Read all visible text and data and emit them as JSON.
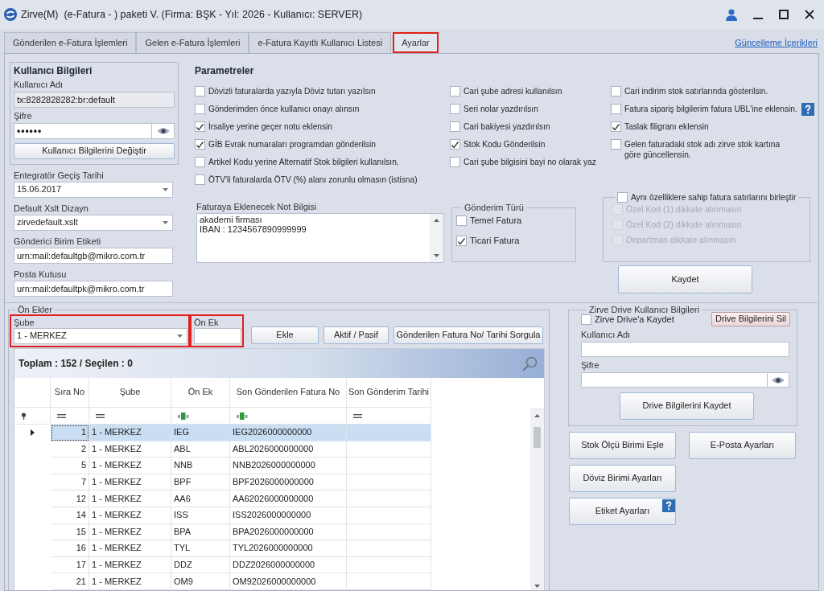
{
  "window": {
    "title": "Zirve(M)  (e-Fatura - ) paketi V. (Firma: BŞK - Yıl: 2026 - Kullanıcı: SERVER)"
  },
  "tabs": [
    {
      "label": "Gönderilen e-Fatura İşlemleri",
      "selected": false,
      "highlighted": false
    },
    {
      "label": "Gelen e-Fatura İşlemleri",
      "selected": false,
      "highlighted": false
    },
    {
      "label": "e-Fatura Kayıtlı Kullanıcı Listesi",
      "selected": false,
      "highlighted": false
    },
    {
      "label": "Ayarlar",
      "selected": true,
      "highlighted": true
    }
  ],
  "update_link": "Güncelleme İçerikleri",
  "user_info": {
    "title": "Kullanıcı Bilgileri",
    "username_label": "Kullanıcı Adı",
    "username": "tx:8282828282:br:default",
    "password_label": "Şifre",
    "password": "••••••",
    "change_button": "Kullanıcı Bilgilerini Değiştir"
  },
  "settings_fields": [
    {
      "kind": "combo",
      "label": "Entegratör Geçiş Tarihi",
      "value": "15.06.2017"
    },
    {
      "kind": "combo",
      "label": "Default Xslt Dizayn",
      "value": "zirvedefault.xslt"
    },
    {
      "kind": "text",
      "label": "Gönderici Birim Etiketi",
      "value": "urn:mail:defaultgb@mikro.com.tr"
    },
    {
      "kind": "text",
      "label": "Posta Kutusu",
      "value": "urn:mail:defaultpk@mikro.com.tr"
    }
  ],
  "parameters": {
    "title": "Parametreler",
    "columns": [
      {
        "options": [
          {
            "label": "Dövizli faturalarda yazıyla Döviz tutarı yazılsın",
            "checked": false
          },
          {
            "label": "Gönderimden önce kullanıcı onayı alınsın",
            "checked": false
          },
          {
            "label": "İrsaliye yerine geçer notu eklensin",
            "checked": true
          },
          {
            "label": "GİB Evrak numaraları programdan gönderilsin",
            "checked": true
          },
          {
            "label": "Artikel Kodu yerine Alternatif Stok bilgileri kullanılsın.",
            "checked": false
          },
          {
            "label": "ÖTV'li faturalarda ÖTV (%) alanı zorunlu olmasın (istisna)",
            "checked": false
          }
        ]
      },
      {
        "options": [
          {
            "label": "Cari şube adresi kullanılsın",
            "checked": false
          },
          {
            "label": "Seri nolar yazdırılsın",
            "checked": false
          },
          {
            "label": "Cari bakiyesi yazdırılsın",
            "checked": false
          },
          {
            "label": "Stok Kodu Gönderilsin",
            "checked": true
          },
          {
            "label": "Cari şube bilgisini bayi no olarak yaz",
            "checked": false
          }
        ]
      },
      {
        "options": [
          {
            "label": "Cari indirim stok satırlarında gösterilsin.",
            "checked": false
          },
          {
            "label": "Fatura sipariş bilgilerim fatura UBL'ine eklensin.",
            "checked": false,
            "help": true
          },
          {
            "label": "Taslak filigranı eklensin",
            "checked": true
          },
          {
            "label": "Gelen faturadaki stok adı zirve stok kartına göre güncellensin.",
            "checked": false
          }
        ]
      }
    ]
  },
  "note": {
    "label": "Faturaya Eklenecek Not Bilgisi",
    "lines": [
      "akademi firması",
      "IBAN : 1234567890999999"
    ]
  },
  "send_type": {
    "title": "Gönderim Türü",
    "options": [
      {
        "label": "Temel Fatura",
        "checked": false
      },
      {
        "label": "Ticari Fatura",
        "checked": true
      }
    ]
  },
  "merge_group": {
    "label": "Aynı özelliklere sahip fatura satırlarını birleştir",
    "checked": false,
    "options": [
      {
        "label": "Özel Kod (1) dikkate alınmasın",
        "checked": false,
        "disabled": true
      },
      {
        "label": "Özel Kod (2) dikkate alınmasın",
        "checked": false,
        "disabled": true
      },
      {
        "label": "Departman dikkate alınmasın",
        "checked": false,
        "disabled": true
      }
    ]
  },
  "save_button": "Kaydet",
  "prefixes": {
    "title": "Ön Ekler",
    "branch": {
      "label": "Şube",
      "value": "1 - MERKEZ",
      "highlighted": true
    },
    "prefix": {
      "label": "Ön Ek",
      "highlighted": true
    },
    "buttons": [
      "Ekle",
      "Aktif / Pasif",
      "Gönderilen Fatura No/ Tarihi Sorgula"
    ],
    "grid": {
      "summary": "Toplam : 152 / Seçilen : 0",
      "columns": [
        "Sıra No",
        "Şube",
        "Ön Ek",
        "Son Gönderilen Fatura No",
        "Son Gönderim Tarihi"
      ],
      "filters": [
        {
          "kind": "equals"
        },
        {
          "kind": "equals"
        },
        {
          "kind": "text"
        },
        {
          "kind": "text"
        },
        {
          "kind": "equals"
        }
      ],
      "rows": [
        {
          "cells": [
            "1",
            "1 - MERKEZ",
            "IEG",
            "IEG2026000000000"
          ],
          "selected": true
        },
        {
          "cells": [
            "2",
            "1 - MERKEZ",
            "ABL",
            "ABL2026000000000"
          ],
          "selected": false
        },
        {
          "cells": [
            "5",
            "1 - MERKEZ",
            "NNB",
            "NNB2026000000000"
          ],
          "selected": false
        },
        {
          "cells": [
            "7",
            "1 - MERKEZ",
            "BPF",
            "BPF2026000000000"
          ],
          "selected": false
        },
        {
          "cells": [
            "12",
            "1 - MERKEZ",
            "AA6",
            "AA62026000000000"
          ],
          "selected": false
        },
        {
          "cells": [
            "14",
            "1 - MERKEZ",
            "ISS",
            "ISS2026000000000"
          ],
          "selected": false
        },
        {
          "cells": [
            "15",
            "1 - MERKEZ",
            "BPA",
            "BPA2026000000000"
          ],
          "selected": false
        },
        {
          "cells": [
            "16",
            "1 - MERKEZ",
            "TYL",
            "TYL2026000000000"
          ],
          "selected": false
        },
        {
          "cells": [
            "17",
            "1 - MERKEZ",
            "DDZ",
            "DDZ2026000000000"
          ],
          "selected": false
        },
        {
          "cells": [
            "21",
            "1 - MERKEZ",
            "OM9",
            "OM92026000000000"
          ],
          "selected": false
        }
      ]
    }
  },
  "drive": {
    "title": "Zirve Drive Kullanıcı Bilgileri",
    "save_option": {
      "label": "Zirve Drive'a Kaydet",
      "checked": false
    },
    "delete_button": "Drive Bilgilerini Sil",
    "username_label": "Kullanıcı Adı",
    "password_label": "Şifre",
    "save_button": "Drive Bilgilerini Kaydet"
  },
  "action_columns": [
    {
      "buttons": [
        {
          "label": "Stok Ölçü Birimi Eşle"
        },
        {
          "label": "Döviz Birimi Ayarları"
        },
        {
          "label": "Etiket Ayarları",
          "help": true
        }
      ]
    },
    {
      "buttons": [
        {
          "label": "E-Posta Ayarları"
        }
      ]
    }
  ]
}
